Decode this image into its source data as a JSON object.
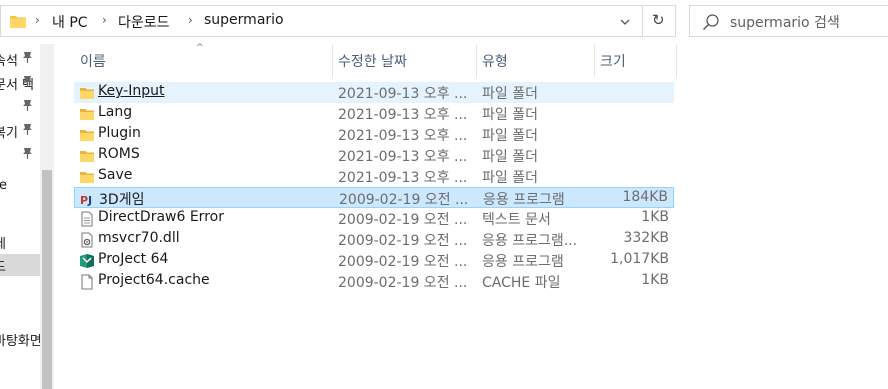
{
  "address": {
    "crumbs": [
      "내 PC",
      "다운로드",
      "supermario"
    ],
    "separator": "›",
    "dropdown_icon": "chevron-down-icon",
    "refresh_icon": "refresh-icon",
    "refresh_glyph": "↻"
  },
  "search": {
    "placeholder": "supermario 검색"
  },
  "nav": {
    "items": [
      {
        "label": "속석",
        "pinned": true
      },
      {
        "label": "문서 텍",
        "pinned": true
      },
      {
        "label": "",
        "pinned": true
      },
      {
        "label": "복기",
        "pinned": true
      },
      {
        "label": "",
        "pinned": true
      },
      {
        "label": "re",
        "pinned": false
      },
      {
        "label": "",
        "pinned": false
      },
      {
        "label": "세",
        "pinned": false
      },
      {
        "label": "드",
        "pinned": false,
        "selected": true
      },
      {
        "label": "",
        "pinned": false
      },
      {
        "label": "",
        "pinned": false
      },
      {
        "label": "바탕화면",
        "pinned": false
      }
    ]
  },
  "columns": {
    "name": "이름",
    "date": "수정한 날짜",
    "type": "유형",
    "size": "크기",
    "sort_glyph": "^"
  },
  "files": [
    {
      "name": "Key-Input",
      "date": "2021-09-13 오후 ...",
      "type": "파일 폴더",
      "size": "",
      "icon": "folder-icon",
      "state": "hover"
    },
    {
      "name": "Lang",
      "date": "2021-09-13 오후 ...",
      "type": "파일 폴더",
      "size": "",
      "icon": "folder-icon",
      "state": ""
    },
    {
      "name": "Plugin",
      "date": "2021-09-13 오후 ...",
      "type": "파일 폴더",
      "size": "",
      "icon": "folder-icon",
      "state": ""
    },
    {
      "name": "ROMS",
      "date": "2021-09-13 오후 ...",
      "type": "파일 폴더",
      "size": "",
      "icon": "folder-icon",
      "state": ""
    },
    {
      "name": "Save",
      "date": "2021-09-13 오후 ...",
      "type": "파일 폴더",
      "size": "",
      "icon": "folder-icon",
      "state": ""
    },
    {
      "name": "3D게임",
      "date": "2009-02-19 오전 ...",
      "type": "응용 프로그램",
      "size": "184KB",
      "icon": "pj-app-icon",
      "state": "selected"
    },
    {
      "name": "DirectDraw6 Error",
      "date": "2009-02-19 오전 ...",
      "type": "텍스트 문서",
      "size": "1KB",
      "icon": "text-document-icon",
      "state": ""
    },
    {
      "name": "msvcr70.dll",
      "date": "2009-02-19 오전 ...",
      "type": "응용 프로그램...",
      "size": "332KB",
      "icon": "dll-gear-icon",
      "state": ""
    },
    {
      "name": "ProJect 64",
      "date": "2009-02-19 오전 ...",
      "type": "응용 프로그램",
      "size": "1,017KB",
      "icon": "project64-app-icon",
      "state": ""
    },
    {
      "name": "Project64.cache",
      "date": "2009-02-19 오전 ...",
      "type": "CACHE 파일",
      "size": "1KB",
      "icon": "blank-file-icon",
      "state": ""
    }
  ]
}
